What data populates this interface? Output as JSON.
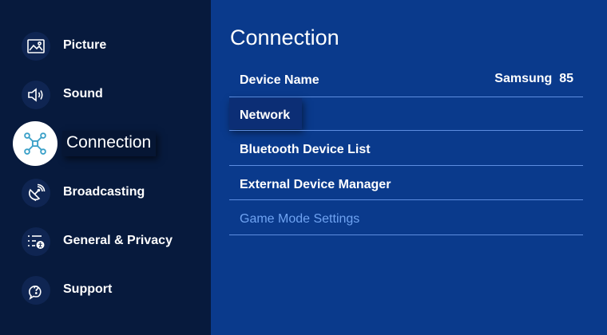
{
  "sidebar": {
    "items": [
      {
        "label": "Picture",
        "icon": "picture-icon"
      },
      {
        "label": "Sound",
        "icon": "speaker-icon"
      },
      {
        "label": "Connection",
        "icon": "connection-icon",
        "active": true
      },
      {
        "label": "Broadcasting",
        "icon": "satellite-dish-icon"
      },
      {
        "label": "General & Privacy",
        "icon": "settings-list-icon"
      },
      {
        "label": "Support",
        "icon": "help-cloud-icon"
      }
    ]
  },
  "main": {
    "title": "Connection",
    "rows": [
      {
        "label": "Device Name",
        "value": "Samsung  85"
      },
      {
        "label": "Network",
        "focused": true
      },
      {
        "label": "Bluetooth Device List"
      },
      {
        "label": "External Device Manager"
      },
      {
        "label": "Game Mode Settings",
        "disabled": true
      }
    ]
  },
  "colors": {
    "sidebar_bg": "#071a3d",
    "main_bg": "#0a3a8c",
    "separator": "#5d8de0",
    "disabled_text": "#6fa3f2",
    "active_icon_bg": "#ffffff"
  }
}
